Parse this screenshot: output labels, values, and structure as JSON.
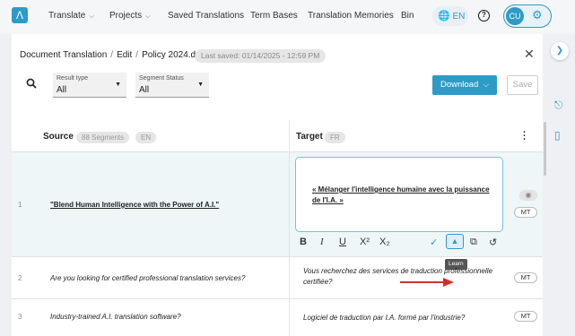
{
  "nav": {
    "items": [
      {
        "label": "Translate",
        "chevron": true
      },
      {
        "label": "Projects",
        "chevron": true
      },
      {
        "label": "Saved Translations",
        "chevron": false
      },
      {
        "label": "Term Bases",
        "chevron": false
      },
      {
        "label": "Translation Memories",
        "chevron": false
      },
      {
        "label": "Bin",
        "chevron": false
      }
    ],
    "language": "EN",
    "user_initials": "CU",
    "accent_color": "#2e9bc6"
  },
  "breadcrumb": [
    "Document Translation",
    "Edit",
    "Policy 2024.docx"
  ],
  "last_saved": "Last saved: 01/14/2025 - 12:59 PM",
  "filters": {
    "result_type": {
      "label": "Result type",
      "value": "All"
    },
    "segment_status": {
      "label": "Segment Status",
      "value": "All"
    }
  },
  "actions": {
    "download": "Download",
    "save": "Save"
  },
  "columns": {
    "source_title": "Source",
    "segments_badge": "88 Segments",
    "source_lang": "EN",
    "target_title": "Target",
    "target_lang": "FR"
  },
  "rows": [
    {
      "num": "1",
      "source": "\"Blend Human Intelligence with the Power of A.I.\"",
      "target": "« Mélanger l'intelligence humaine avec la puissance de l'I.A. »",
      "badge": "MT",
      "editing": true
    },
    {
      "num": "2",
      "source": "Are you looking for certified professional translation services?",
      "target": "Vous recherchez des services de traduction professionnelle certifiée?",
      "badge": "MT",
      "editing": false
    },
    {
      "num": "3",
      "source": "Industry-trained A.I. translation software?",
      "target": "Logiciel de traduction par I.A. formé par l'industrie?",
      "badge": "MT",
      "editing": false
    }
  ],
  "toolbar": {
    "bold": "B",
    "italic": "I",
    "underline": "U",
    "superscript": "X²",
    "subscript": "X₂",
    "tooltip": "Learn"
  }
}
